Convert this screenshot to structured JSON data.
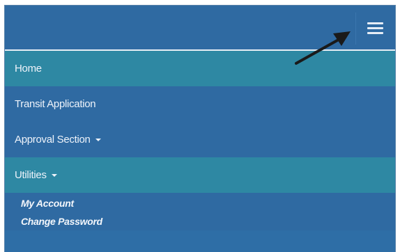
{
  "navbar": {
    "toggle_icon": "hamburger-menu-icon"
  },
  "annotation": {
    "icon": "arrow-pointer-icon",
    "color": "#1a1a1a"
  },
  "menu": {
    "items": [
      {
        "label": "Home"
      },
      {
        "label": "Transit Application"
      },
      {
        "label": "Approval Section"
      },
      {
        "label": "Utilities"
      }
    ],
    "utilities_submenu": [
      {
        "label": "My Account"
      },
      {
        "label": "Change Password"
      }
    ]
  },
  "colors": {
    "navbar_bg": "#2f6aa2",
    "highlight_bg": "#2e88a3",
    "text": "#eef3fa"
  }
}
